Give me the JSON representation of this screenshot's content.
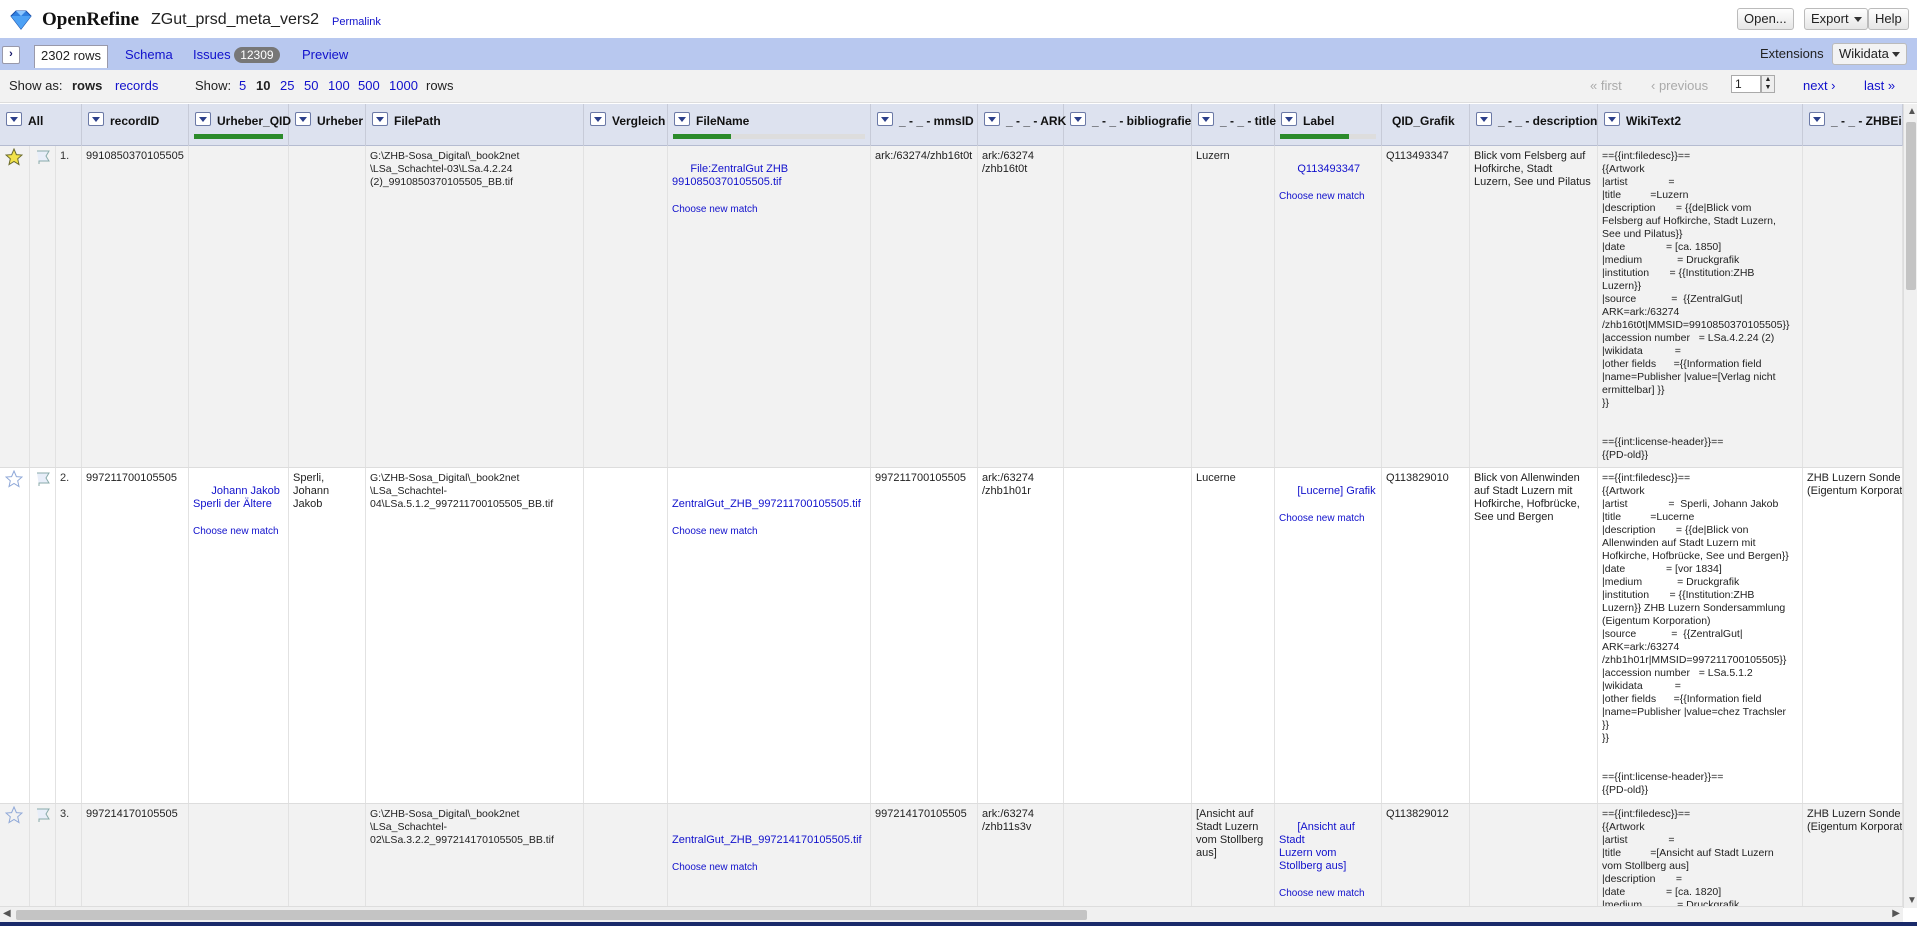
{
  "header": {
    "app_name": "OpenRefine",
    "project_name": "ZGut_prsd_meta_vers2",
    "permalink": "Permalink",
    "open_label": "Open...",
    "export_label": "Export",
    "help_label": "Help"
  },
  "tabs": {
    "rows": "2302 rows",
    "schema": "Schema",
    "issues": "Issues",
    "issues_count": "12309",
    "preview": "Preview",
    "extensions_label": "Extensions",
    "extensions_value": "Wikidata"
  },
  "view": {
    "show_as": "Show as:",
    "rows": "rows",
    "records": "records",
    "show": "Show:",
    "page_sizes": [
      "5",
      "10",
      "25",
      "50",
      "100",
      "500",
      "1000"
    ],
    "active_page_size": "10",
    "rows_suffix": "rows",
    "first": "« first",
    "previous": "‹ previous",
    "page": "1",
    "next": "next ›",
    "last": "last »"
  },
  "columns": [
    {
      "label": "All"
    },
    {
      "label": "recordID"
    },
    {
      "label": "Urheber_QID",
      "matched": 1.0
    },
    {
      "label": "Urheber"
    },
    {
      "label": "FilePath"
    },
    {
      "label": "Vergleich"
    },
    {
      "label": "FileName",
      "matched": 0.3
    },
    {
      "label": "_ - _ - mmsID"
    },
    {
      "label": "_ - _ - ARK"
    },
    {
      "label": "_ - _ - bibliografie"
    },
    {
      "label": "_ - _ - title"
    },
    {
      "label": "Label",
      "matched": 0.72
    },
    {
      "label": "QID_Grafik"
    },
    {
      "label": "_ - _ - description"
    },
    {
      "label": "WikiText2"
    },
    {
      "label": "_ - _ - ZHBEige"
    }
  ],
  "rows": [
    {
      "num": "1.",
      "starred": true,
      "recordID": "9910850370105505",
      "urheber_qid": "",
      "urheber": "",
      "filepath": "G:\\ZHB-Sosa_Digital\\_book2net\n\\LSa_Schachtel-03\\LSa.4.2.24\n(2)_9910850370105505_BB.tif",
      "vergleich": "",
      "filename": "File:ZentralGut ZHB\n9910850370105505.tif",
      "mmsid": "ark:/63274/zhb16t0t",
      "ark": "ark:/63274\n/zhb16t0t",
      "bibliografie": "",
      "title": "Luzern",
      "label": "Q113493347",
      "qid_grafik": "Q113493347",
      "description": "Blick vom Felsberg auf\nHofkirche, Stadt\nLuzern, See und Pilatus",
      "wikitext": "=={{int:filedesc}}==\n{{Artwork\n|artist              =\n|title          =Luzern\n|description       = {{de|Blick vom\nFelsberg auf Hofkirche, Stadt Luzern,\nSee und Pilatus}}\n|date              = [ca. 1850]\n|medium            = Druckgrafik\n|institution       = {{Institution:ZHB\nLuzern}}\n|source            =  {{ZentralGut|\nARK=ark:/63274\n/zhb16t0t|MMSID=9910850370105505}}\n|accession number   = LSa.4.2.24 (2)\n|wikidata           =\n|other fields      ={{Information field\n|name=Publisher |value=[Verlag nicht\nermittelbar] }}\n}}\n\n\n=={{int:license-header}}==\n{{PD-old}}",
      "zhbeige": ""
    },
    {
      "num": "2.",
      "starred": false,
      "recordID": "997211700105505",
      "urheber_qid": "Johann Jakob\nSperli der Ältere",
      "urheber": "Sperli,\nJohann Jakob",
      "filepath": "G:\\ZHB-Sosa_Digital\\_book2net\n\\LSa_Schachtel-\n04\\LSa.5.1.2_997211700105505_BB.tif",
      "vergleich": "",
      "filename": "ZentralGut_ZHB_997211700105505.tif",
      "mmsid": "997211700105505",
      "ark": "ark:/63274\n/zhb1h01r",
      "bibliografie": "",
      "title": "Lucerne",
      "label": "[Lucerne] Grafik",
      "qid_grafik": "Q113829010",
      "description": "Blick von Allenwinden\nauf Stadt Luzern mit\nHofkirche, Hofbrücke,\nSee und Bergen",
      "wikitext": "=={{int:filedesc}}==\n{{Artwork\n|artist              =  Sperli, Johann Jakob\n|title          =Lucerne\n|description       = {{de|Blick von\nAllenwinden auf Stadt Luzern mit\nHofkirche, Hofbrücke, See und Bergen}}\n|date              = [vor 1834]\n|medium            = Druckgrafik\n|institution       = {{Institution:ZHB\nLuzern}} ZHB Luzern Sondersammlung\n(Eigentum Korporation)\n|source            =  {{ZentralGut|\nARK=ark:/63274\n/zhb1h01r|MMSID=997211700105505}}\n|accession number   = LSa.5.1.2\n|wikidata           =\n|other fields      ={{Information field\n|name=Publisher |value=chez Trachsler\n}}\n}}\n\n\n=={{int:license-header}}==\n{{PD-old}}",
      "zhbeige": "ZHB Luzern Sonde\n(Eigentum Korporat"
    },
    {
      "num": "3.",
      "starred": false,
      "recordID": "997214170105505",
      "urheber_qid": "",
      "urheber": "",
      "filepath": "G:\\ZHB-Sosa_Digital\\_book2net\n\\LSa_Schachtel-\n02\\LSa.3.2.2_997214170105505_BB.tif",
      "vergleich": "",
      "filename": "ZentralGut_ZHB_997214170105505.tif",
      "mmsid": "997214170105505",
      "ark": "ark:/63274\n/zhb11s3v",
      "bibliografie": "",
      "title": "[Ansicht auf\nStadt Luzern\nvom Stollberg\naus]",
      "label": "[Ansicht auf Stadt\nLuzern vom\nStollberg aus]",
      "qid_grafik": "Q113829012",
      "description": "",
      "wikitext": "=={{int:filedesc}}==\n{{Artwork\n|artist              =\n|title          =[Ansicht auf Stadt Luzern\nvom Stollberg aus]\n|description       =\n|date              = [ca. 1820]\n|medium            = Druckgrafik",
      "zhbeige": "ZHB Luzern Sonde\n(Eigentum Korporat"
    }
  ],
  "choose_new_match": "Choose new match",
  "colors": {
    "tabs_bar": "#b8c8ef",
    "header_row": "#dde2ef",
    "link": "#1111cc",
    "match_bar": "#2b8b2b"
  }
}
